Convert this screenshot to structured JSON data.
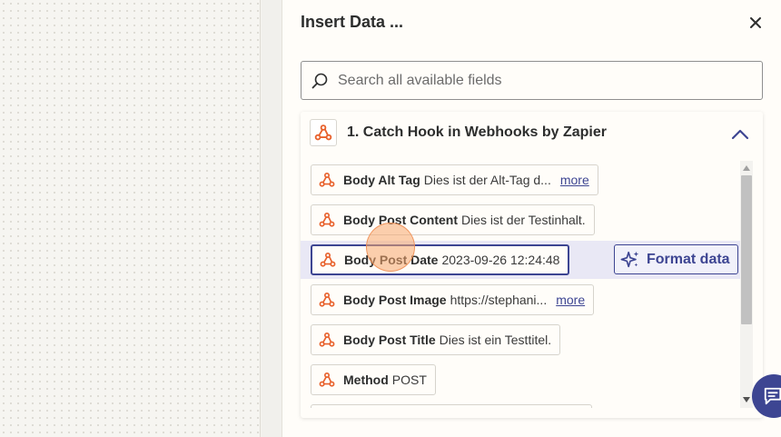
{
  "dialog": {
    "title": "Insert Data ...",
    "close_icon": "close-icon"
  },
  "search": {
    "placeholder": "Search all available fields",
    "value": ""
  },
  "group": {
    "title": "1. Catch Hook in Webhooks by Zapier",
    "app_icon": "webhook-icon",
    "expanded": true
  },
  "fields": [
    {
      "key": "Body Alt Tag",
      "value": "Dies ist der Alt-Tag d...",
      "more": "more"
    },
    {
      "key": "Body Post Content",
      "value": "Dies ist der Testinhalt.",
      "more": ""
    },
    {
      "key": "Body Post Date",
      "value": "2023-09-26 12:24:48",
      "more": ""
    },
    {
      "key": "Body Post Image",
      "value": "https://stephani...",
      "more": "more"
    },
    {
      "key": "Body Post Title",
      "value": "Dies ist ein Testtitel.",
      "more": ""
    },
    {
      "key": "Method",
      "value": "POST",
      "more": ""
    }
  ],
  "format_button": {
    "label": "Format data",
    "icon": "sparkle-icon"
  },
  "colors": {
    "accent": "#3d4592",
    "webhook": "#e8612c",
    "highlight": "#e9e8f5"
  }
}
